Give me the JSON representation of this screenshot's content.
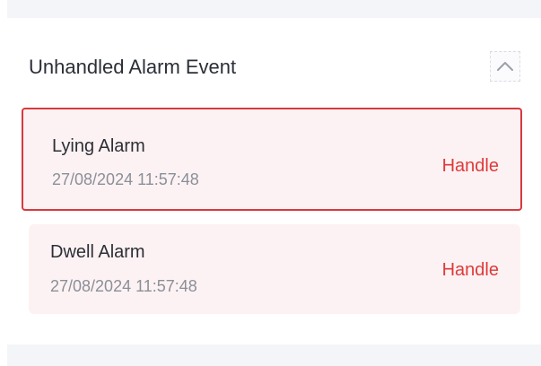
{
  "panel": {
    "title": "Unhandled Alarm Event",
    "collapse_icon": "chevron-up-icon"
  },
  "alarms": [
    {
      "name": "Lying Alarm",
      "time": "27/08/2024 11:57:48",
      "action": "Handle",
      "selected": true
    },
    {
      "name": "Dwell Alarm",
      "time": "27/08/2024 11:57:48",
      "action": "Handle",
      "selected": false
    }
  ],
  "colors": {
    "accent_red": "#de3a3a",
    "selected_border": "#d8393f",
    "card_background": "#fdf2f3",
    "title_text": "#2b2f36",
    "muted_text": "#8b8f98"
  }
}
